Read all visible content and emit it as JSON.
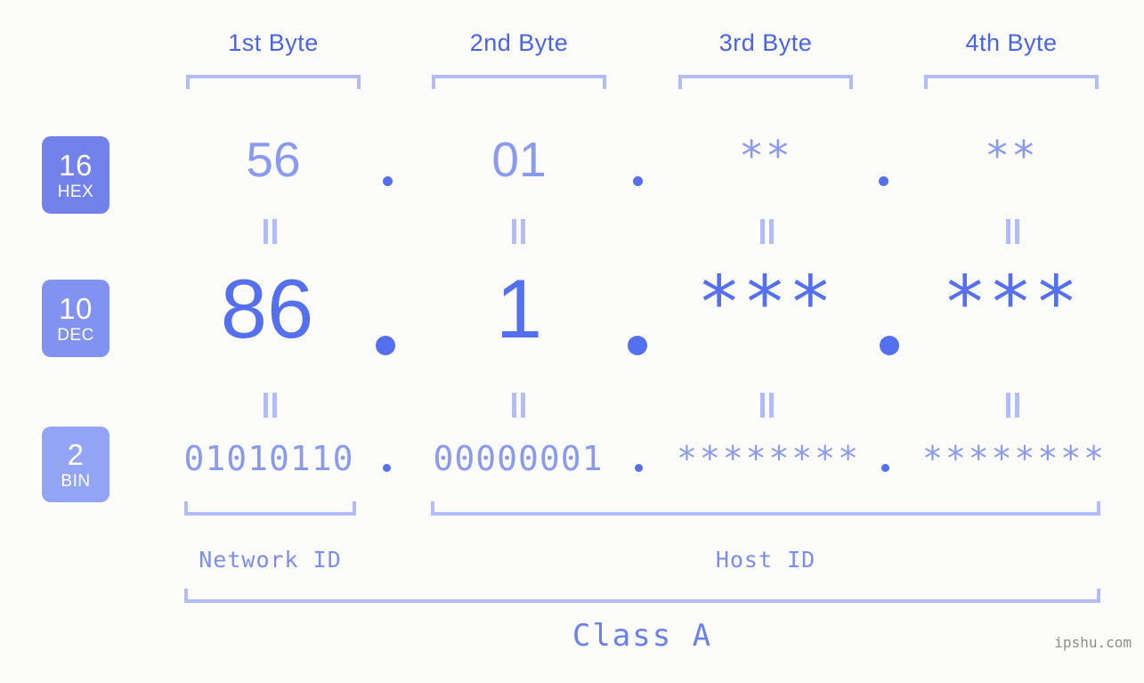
{
  "background_color": "#fcfdfa",
  "colors": {
    "header_label": "#4a63e7",
    "bracket": "#b2bcfa",
    "hex_value": "#8a9aef",
    "dec_value": "#5570ee",
    "bin_value": "#8a9aef",
    "badge_hex": "#7382ea",
    "badge_dec": "#8292f0",
    "badge_bin": "#93a4f5",
    "caption": "#7b8cf2",
    "watermark": "#8d8d8d"
  },
  "byte_headers": [
    {
      "label": "1st Byte"
    },
    {
      "label": "2nd Byte"
    },
    {
      "label": "3rd Byte"
    },
    {
      "label": "4th Byte"
    }
  ],
  "radix_badges": [
    {
      "num": "16",
      "unit": "HEX"
    },
    {
      "num": "10",
      "unit": "DEC"
    },
    {
      "num": "2",
      "unit": "BIN"
    }
  ],
  "rows": {
    "hex": {
      "values": [
        "56",
        "01",
        "**",
        "**"
      ]
    },
    "dec": {
      "values": [
        "86",
        "1",
        "***",
        "***"
      ]
    },
    "bin": {
      "values": [
        "01010110",
        "00000001",
        "********",
        "********"
      ]
    }
  },
  "separator": ".",
  "equals_sign": "=",
  "segments": {
    "network_id": "Network ID",
    "host_id": "Host ID",
    "class": "Class A"
  },
  "watermark": "ipshu.com"
}
